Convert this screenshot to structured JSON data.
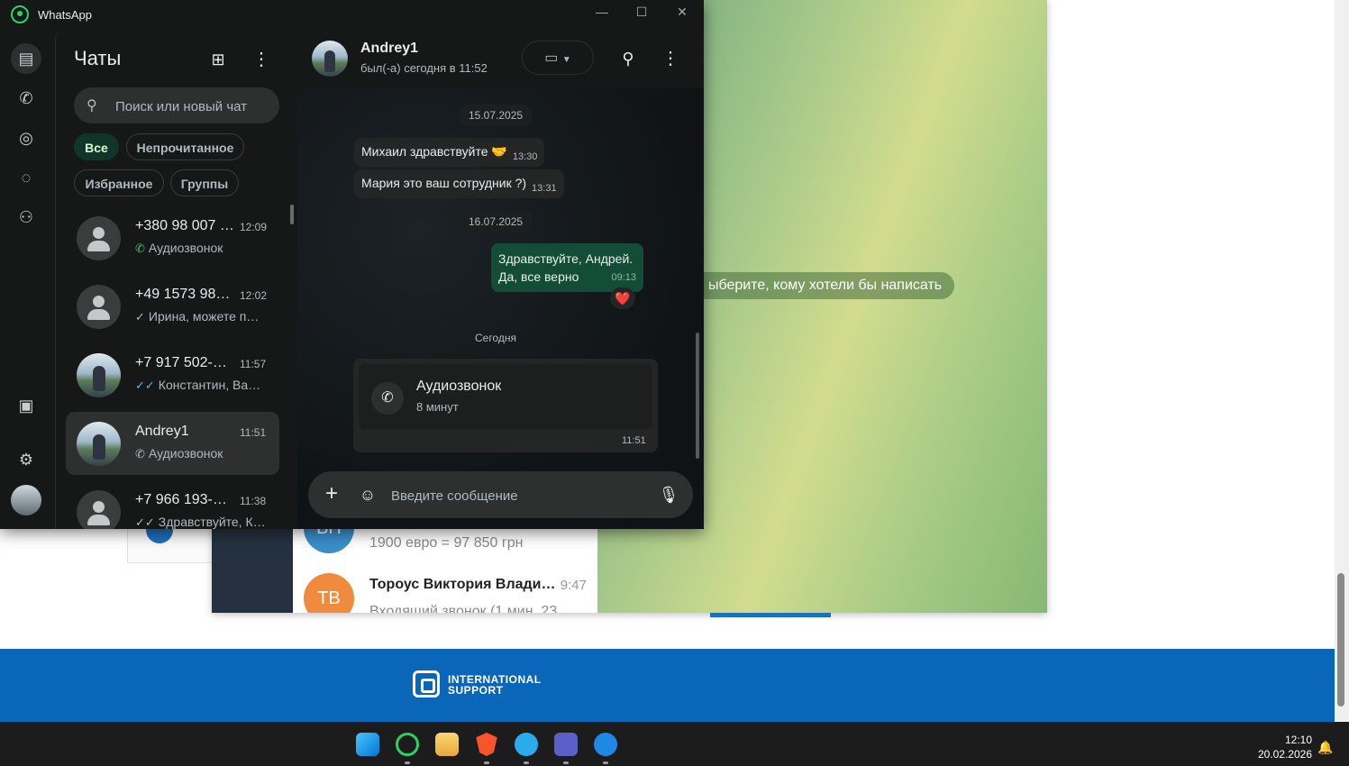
{
  "background_page": {
    "footer_logo_line1": "INTERNATIONAL",
    "footer_logo_line2": "SUPPORT"
  },
  "telegram": {
    "empty_hint": "ыберите, кому хотели бы написать",
    "chats": [
      {
        "initials": "ВН",
        "name": "",
        "preview": "1900 евро = 97 850 грн",
        "time": "",
        "avatar_color": "#3a8ec9"
      },
      {
        "initials": "ТВ",
        "name": "Тороус Виктория Влади…",
        "preview": "Входящий звонок (1 мин. 23",
        "time": "9:47",
        "avatar_color": "#f08a3c"
      }
    ]
  },
  "whatsapp": {
    "app_title": "WhatsApp",
    "window_controls": {
      "minimize": "—",
      "maximize": "☐",
      "close": "✕"
    },
    "sidebar_title": "Чаты",
    "search_placeholder": "Поиск или новый чат",
    "filters": [
      {
        "label": "Все",
        "active": true
      },
      {
        "label": "Непрочитанное",
        "active": false
      },
      {
        "label": "Избранное",
        "active": false
      },
      {
        "label": "Группы",
        "active": false
      }
    ],
    "chats": [
      {
        "name": "+380 98 007 …",
        "time": "12:09",
        "preview": "Аудиозвонок",
        "status_icon": "incoming-call-icon",
        "avatar": "placeholder",
        "selected": false
      },
      {
        "name": "+49 1573 981…",
        "time": "12:02",
        "preview": "Ирина, можете п…",
        "status_icon": "single-check-icon",
        "avatar": "placeholder",
        "selected": false
      },
      {
        "name": "+7 917 502-9…",
        "time": "11:57",
        "preview": "Константин, Ва…",
        "status_icon": "double-check-icon",
        "avatar": "photo",
        "selected": false
      },
      {
        "name": "Andrey1",
        "time": "11:51",
        "preview": "Аудиозвонок",
        "status_icon": "missed-call-icon",
        "avatar": "photo",
        "selected": true
      },
      {
        "name": "+7 966 193-1…",
        "time": "11:38",
        "preview": "Здравствуйте, К…",
        "status_icon": "double-check-icon",
        "avatar": "placeholder",
        "selected": false
      }
    ],
    "active_chat": {
      "name": "Andrey1",
      "status": "был(-а) сегодня в 11:52",
      "date_1": "15.07.2025",
      "msg_1": {
        "text": "Михаил здравствуйте 🤝",
        "time": "13:30"
      },
      "msg_2": {
        "text": "Мария это ваш сотрудник ?)",
        "time": "13:31"
      },
      "date_2": "16.07.2025",
      "msg_3": {
        "line1": "Здравствуйте, Андрей.",
        "line2": "Да, все верно",
        "time": "09:13",
        "reaction": "❤️"
      },
      "date_3": "Сегодня",
      "call": {
        "title": "Аудиозвонок",
        "duration": "8 минут",
        "time": "11:51"
      },
      "composer_placeholder": "Введите сообщение"
    }
  },
  "taskbar": {
    "time": "12:10",
    "date": "20.02.2026",
    "apps": [
      "windows-start-icon",
      "whatsapp-icon",
      "file-explorer-icon",
      "brave-icon",
      "telegram-icon",
      "teams-icon",
      "phone-app-icon"
    ]
  }
}
